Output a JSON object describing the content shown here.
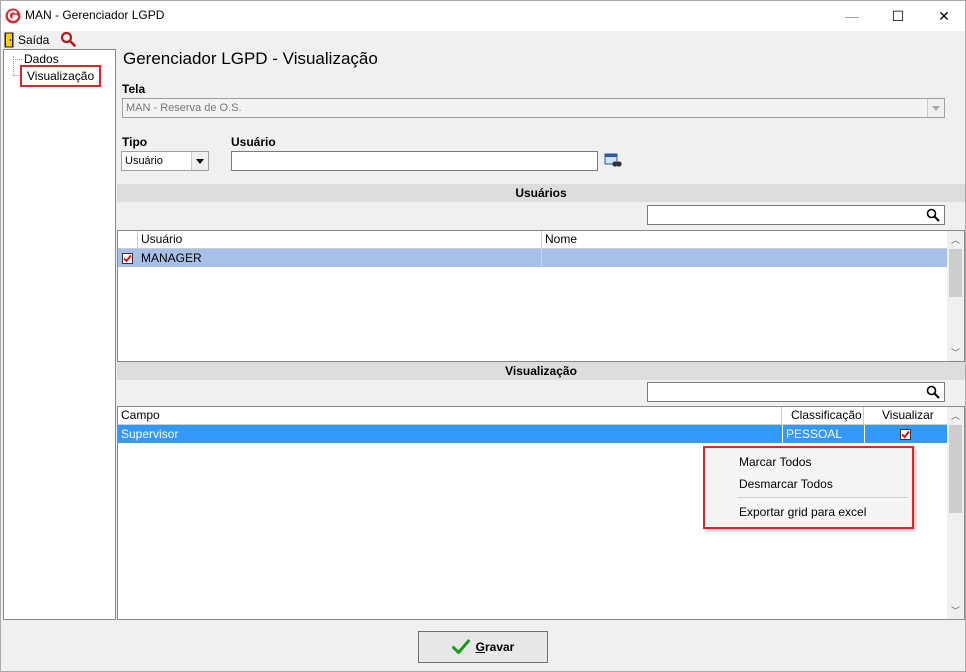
{
  "window": {
    "title": "MAN - Gerenciador LGPD",
    "controls": {
      "minimize": "—",
      "maximize": "☐",
      "close": "✕"
    }
  },
  "toolbar": {
    "exit_label": "Saída"
  },
  "tree": {
    "items": [
      {
        "label": "Dados"
      },
      {
        "label": "Visualização"
      }
    ]
  },
  "panel": {
    "title": "Gerenciador LGPD - Visualização"
  },
  "form": {
    "tela_label": "Tela",
    "tela_value": "MAN - Reserva de O.S.",
    "tipo_label": "Tipo",
    "tipo_value": "Usuário",
    "usuario_label": "Usuário",
    "usuario_value": ""
  },
  "users_section": {
    "title": "Usuários",
    "search_value": "",
    "columns": [
      "Usuário",
      "Nome"
    ],
    "rows": [
      {
        "usuario": "MANAGER",
        "nome": "",
        "checked": true
      }
    ]
  },
  "view_section": {
    "title": "Visualização",
    "search_value": "",
    "columns": [
      "Campo",
      "Classificação",
      "Visualizar"
    ],
    "rows": [
      {
        "campo": "Supervisor",
        "classificacao": "PESSOAL",
        "visualizar": true
      }
    ]
  },
  "context_menu": {
    "items": [
      "Marcar Todos",
      "Desmarcar Todos",
      "Exportar grid para excel"
    ]
  },
  "save_button": {
    "label_underlined": "G",
    "label_rest": "ravar"
  },
  "colors": {
    "selection_light": "#a8bfe8",
    "selection_dark": "#3399ff",
    "highlight_border": "#d9262a",
    "check_green": "#1a9a1a"
  }
}
